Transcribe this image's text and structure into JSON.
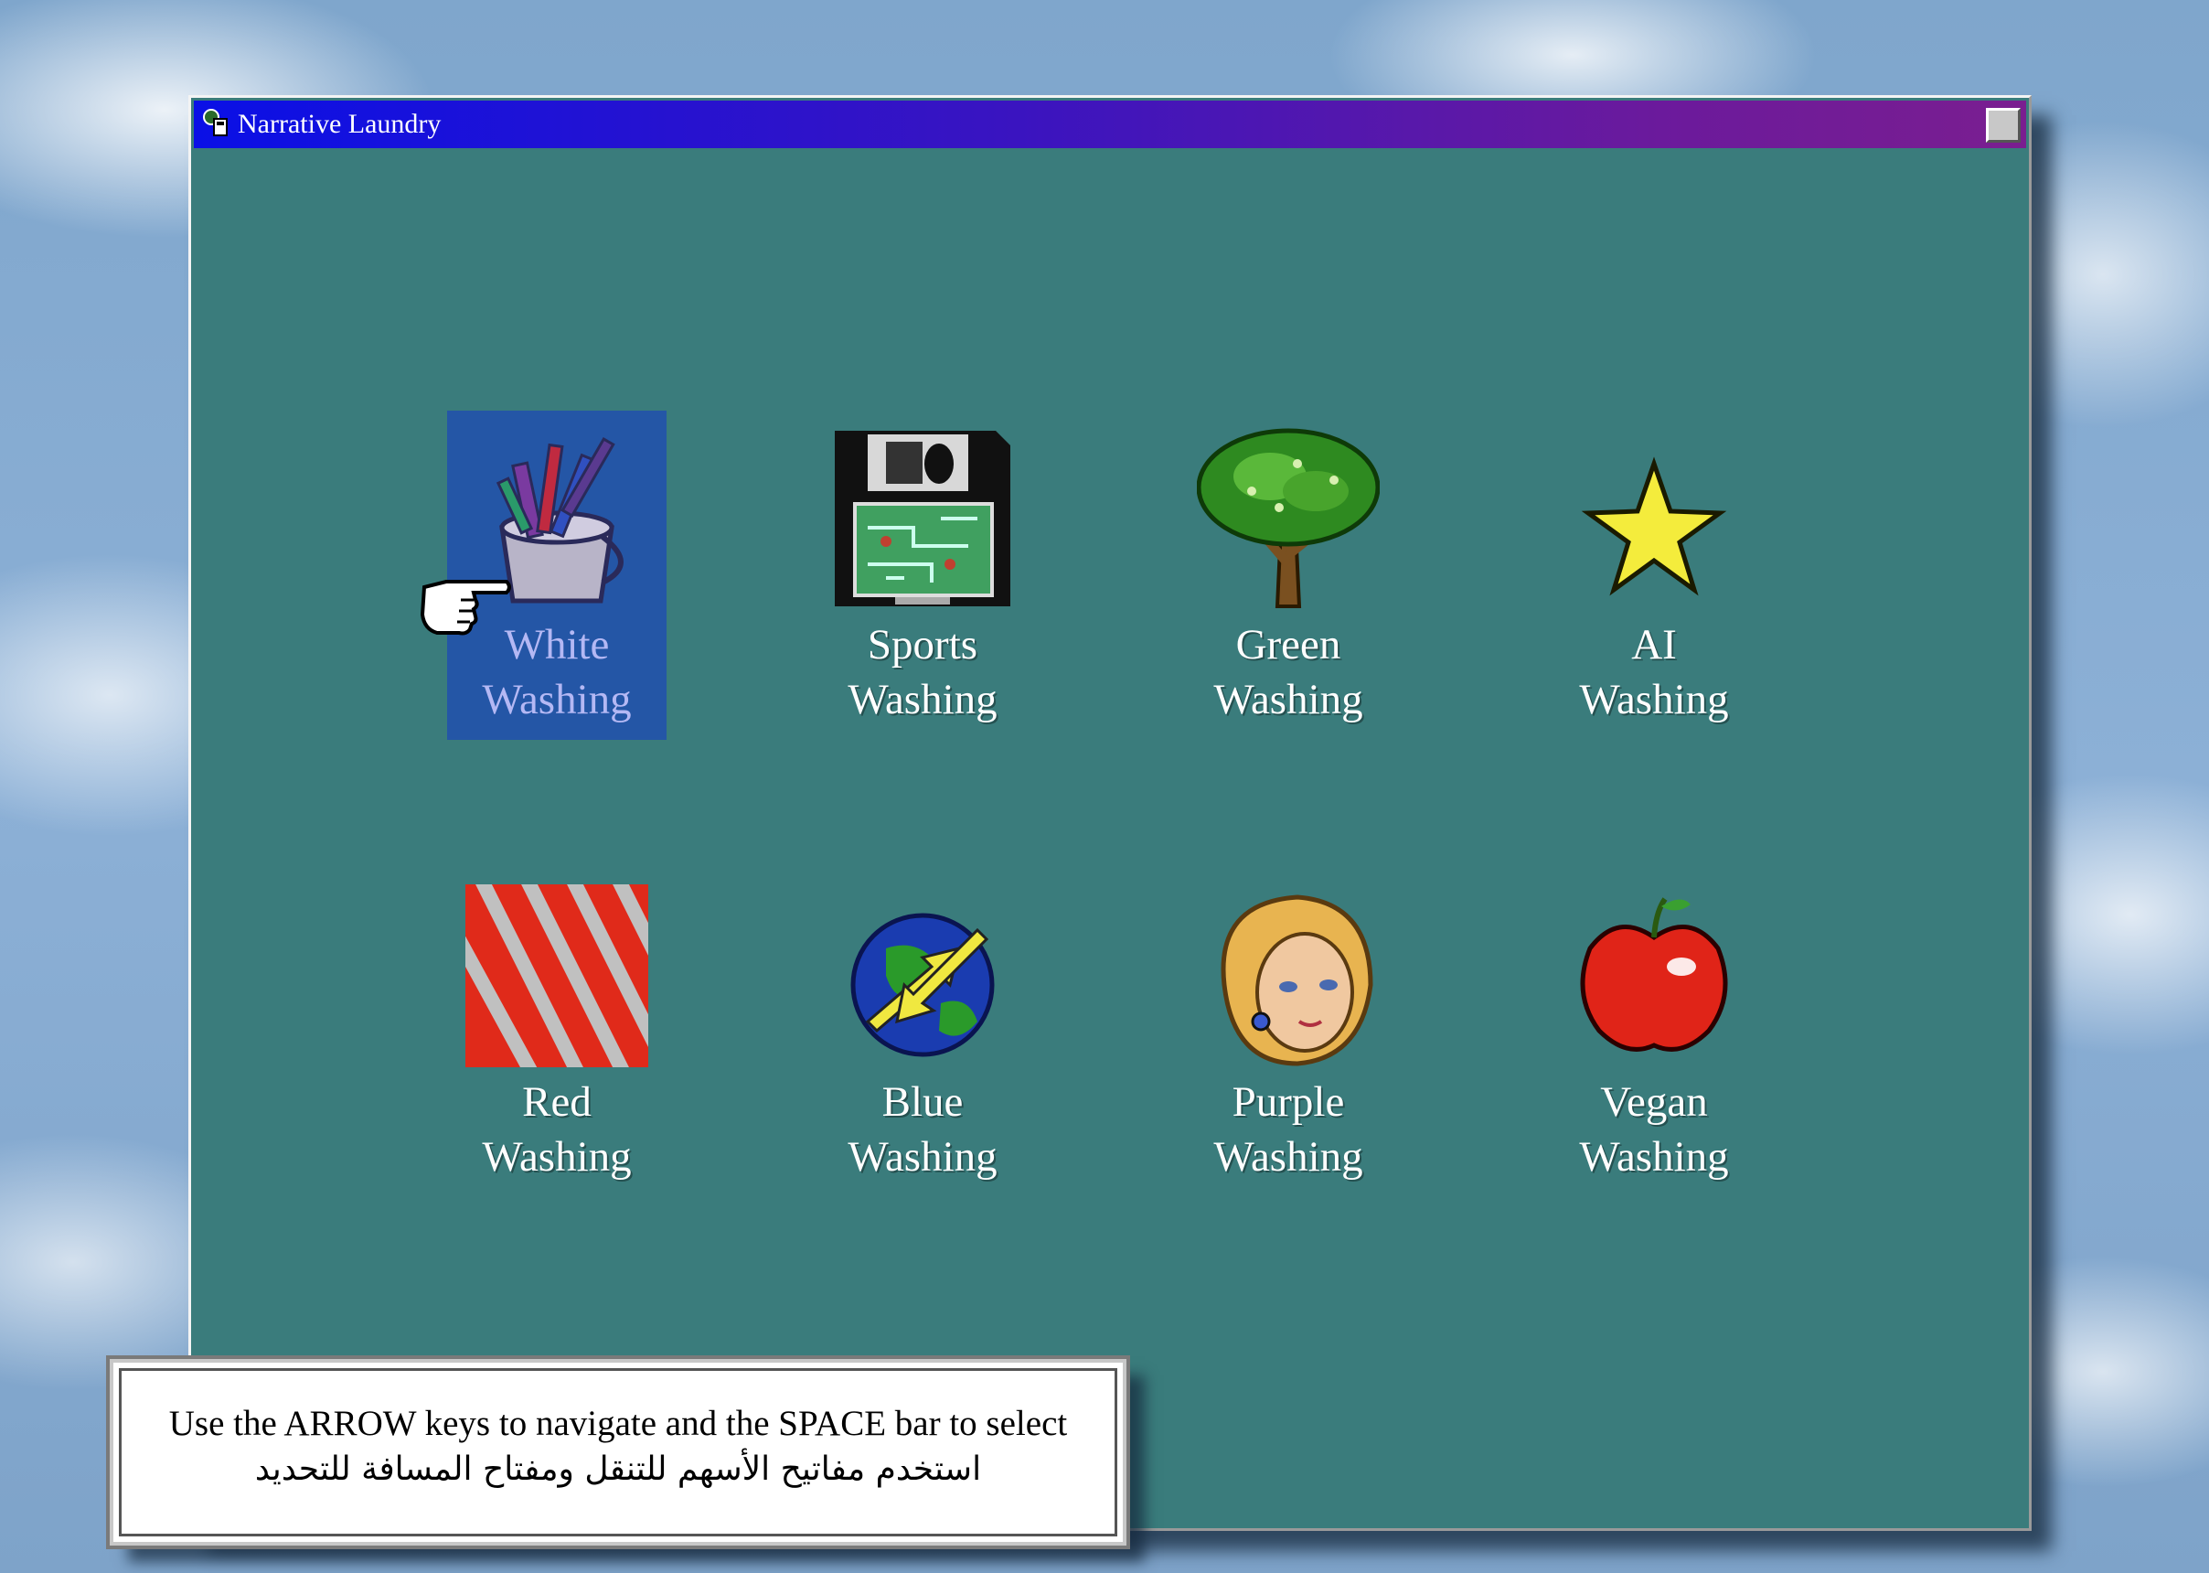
{
  "window": {
    "title": "Narrative Laundry",
    "title_icon": "app-icon",
    "close_icon": "window-button-icon"
  },
  "tiles": [
    {
      "line1": "White",
      "line2": "Washing",
      "icon": "paint-bucket-icon",
      "selected": true
    },
    {
      "line1": "Sports",
      "line2": "Washing",
      "icon": "floppy-disk-icon",
      "selected": false
    },
    {
      "line1": "Green",
      "line2": "Washing",
      "icon": "tree-icon",
      "selected": false
    },
    {
      "line1": "AI",
      "line2": "Washing",
      "icon": "star-icon",
      "selected": false
    },
    {
      "line1": "Red",
      "line2": "Washing",
      "icon": "red-stripes-icon",
      "selected": false
    },
    {
      "line1": "Blue",
      "line2": "Washing",
      "icon": "globe-arrows-icon",
      "selected": false
    },
    {
      "line1": "Purple",
      "line2": "Washing",
      "icon": "woman-face-icon",
      "selected": false
    },
    {
      "line1": "Vegan",
      "line2": "Washing",
      "icon": "apple-icon",
      "selected": false
    }
  ],
  "instructions": {
    "english": "Use the ARROW keys to navigate and the SPACE bar to select",
    "arabic": "استخدم مفاتيح الأسهم للتنقل ومفتاح المسافة للتحديد"
  },
  "colors": {
    "window_bg": "#3a7c7c",
    "selection": "#2456a6",
    "selected_label": "#b4b8f4",
    "titlebar_start": "#0a10e6",
    "titlebar_end": "#7a1e90"
  },
  "cursor": "pointing-hand-cursor-icon"
}
